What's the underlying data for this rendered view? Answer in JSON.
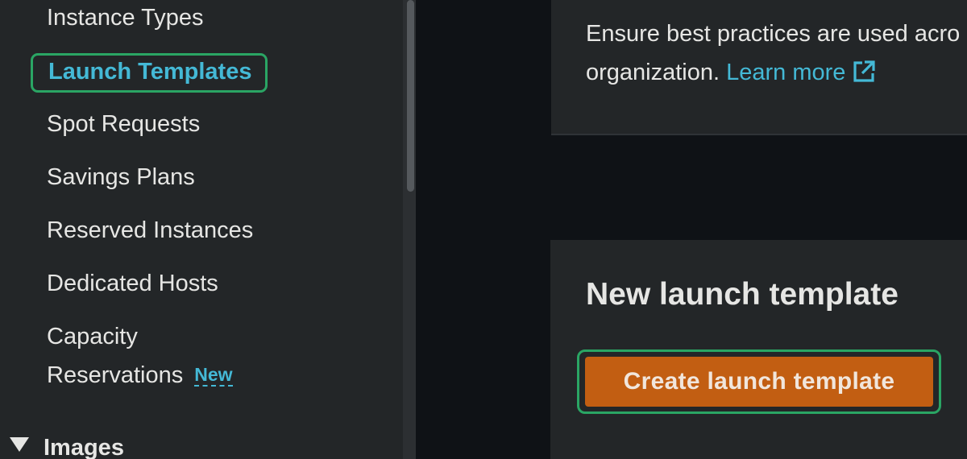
{
  "sidebar": {
    "items": [
      {
        "label": "Instance Types"
      },
      {
        "label": "Launch Templates"
      },
      {
        "label": "Spot Requests"
      },
      {
        "label": "Savings Plans"
      },
      {
        "label": "Reserved Instances"
      },
      {
        "label": "Dedicated Hosts"
      },
      {
        "label_line1": "Capacity",
        "label_line2": "Reservations",
        "badge": "New"
      }
    ],
    "section": {
      "label": "Images",
      "icon": "caret-down-icon"
    }
  },
  "main": {
    "info_card": {
      "text_line1": "Ensure best practices are used acro",
      "text_line2": "organization.",
      "learn_more": "Learn more",
      "learn_more_icon": "external-link-icon"
    },
    "new_template_card": {
      "title": "New launch template",
      "create_button": "Create launch template"
    }
  },
  "colors": {
    "accent_link": "#44b9d6",
    "highlight_outline": "#2aa564",
    "primary_button": "#c25e12",
    "sidebar_bg": "#232628",
    "page_bg": "#0f1216"
  }
}
